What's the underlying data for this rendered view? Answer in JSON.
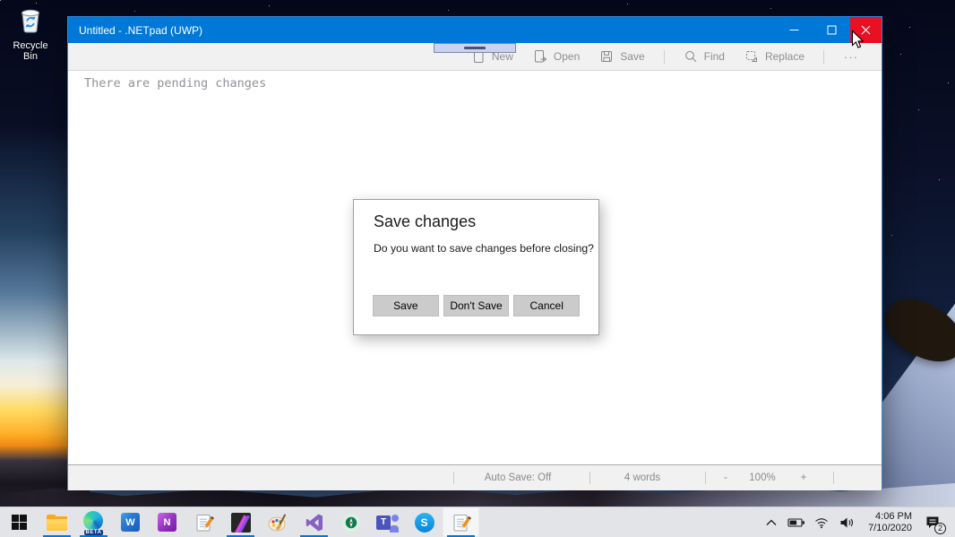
{
  "desktop": {
    "recycle_bin_label": "Recycle Bin"
  },
  "window": {
    "title": "Untitled - .NETpad (UWP)",
    "toolbar": {
      "buttons": [
        {
          "label": "New"
        },
        {
          "label": "Open"
        },
        {
          "label": "Save"
        },
        {
          "label": "Find"
        },
        {
          "label": "Replace"
        }
      ],
      "more_label": "···"
    },
    "editor": {
      "text": "There are pending changes"
    },
    "statusbar": {
      "auto_save": "Auto Save: Off",
      "word_count": "4 words",
      "zoom_out": "-",
      "zoom_level": "100%",
      "zoom_in": "+"
    }
  },
  "dialog": {
    "title": "Save changes",
    "message": "Do you want to save changes before closing?",
    "buttons": [
      {
        "label": "Save"
      },
      {
        "label": "Don't Save"
      },
      {
        "label": "Cancel"
      }
    ]
  },
  "taskbar": {
    "icons": [
      {
        "name": "start"
      },
      {
        "name": "file-explorer"
      },
      {
        "name": "edge-beta",
        "badge": "BETA"
      },
      {
        "name": "word",
        "glyph": "W"
      },
      {
        "name": "onenote",
        "glyph": "N"
      },
      {
        "name": "notepad"
      },
      {
        "name": "photo-editor"
      },
      {
        "name": "paint"
      },
      {
        "name": "visual-studio"
      },
      {
        "name": "android-studio"
      },
      {
        "name": "teams",
        "glyph": "T"
      },
      {
        "name": "skype",
        "glyph": "S"
      },
      {
        "name": "netpad-active"
      }
    ],
    "tray": {
      "time": "4:06 PM",
      "date": "7/10/2020",
      "notification_count": "2"
    }
  },
  "colors": {
    "accent": "#0078D7",
    "close_button": "#E81123",
    "taskbar_underline": "#0078D7"
  }
}
